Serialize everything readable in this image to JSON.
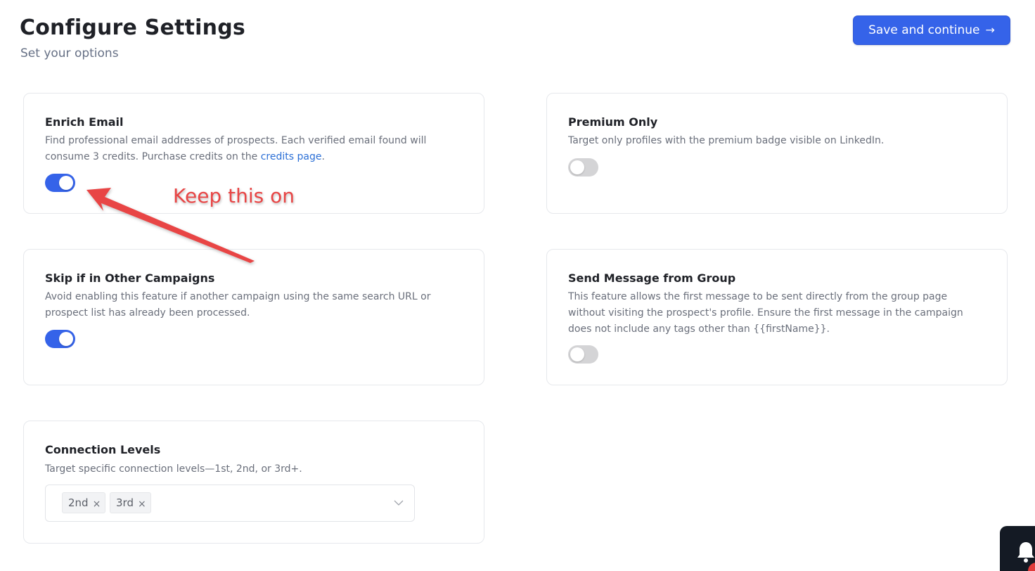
{
  "header": {
    "title": "Configure Settings",
    "subtitle": "Set your options",
    "save_label": "Save and continue",
    "save_icon": "→"
  },
  "cards": {
    "enrich_email": {
      "title": "Enrich Email",
      "description_prefix": "Find professional email addresses of prospects. Each verified email found will consume 3 credits. Purchase credits on the",
      "link_text": "credits page",
      "description_suffix": ".",
      "enabled": true
    },
    "premium_only": {
      "title": "Premium Only",
      "description": "Target only profiles with the premium badge visible on LinkedIn.",
      "enabled": false
    },
    "skip_other_campaigns": {
      "title": "Skip if in Other Campaigns",
      "description": "Avoid enabling this feature if another campaign using the same search URL or prospect list has already been processed.",
      "enabled": true
    },
    "send_from_group": {
      "title": "Send Message from Group",
      "description": "This feature allows the first message to be sent directly from the group page without visiting the prospect's profile. Ensure the first message in the campaign does not include any tags other than {{firstName}}.",
      "enabled": false
    },
    "connection_levels": {
      "title": "Connection Levels",
      "description": "Target specific connection levels—1st, 2nd, or 3rd+.",
      "selected": [
        "2nd",
        "3rd"
      ],
      "remove_glyph": "×"
    }
  },
  "annotation": {
    "text": "Keep this on",
    "color": "#e84545"
  },
  "colors": {
    "accent": "#3563e9",
    "toggle_off": "#d4d4d6",
    "link": "#2b6fd6"
  }
}
